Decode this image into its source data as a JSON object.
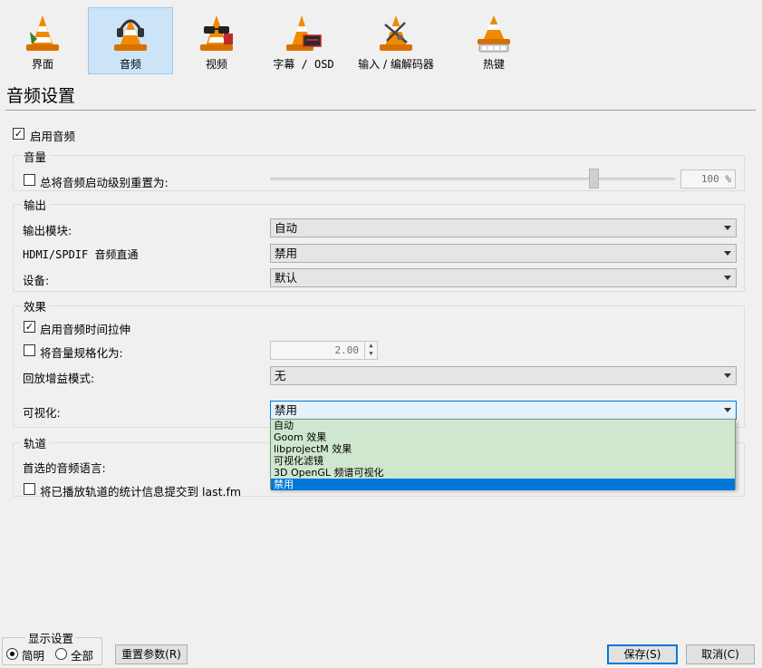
{
  "toolbar": {
    "items": [
      {
        "label": "界面",
        "icon": "vlc-cone-interface-icon"
      },
      {
        "label": "音频",
        "icon": "vlc-cone-headphones-icon"
      },
      {
        "label": "视频",
        "icon": "vlc-cone-glasses-icon"
      },
      {
        "label": "字幕 / OSD",
        "icon": "vlc-cone-subtitle-icon"
      },
      {
        "label": "输入 / 编解码器",
        "icon": "vlc-cone-codec-icon"
      },
      {
        "label": "热键",
        "icon": "vlc-cone-hotkeys-icon"
      }
    ],
    "active": "音频"
  },
  "page_title": "音频设置",
  "enable_audio": {
    "label": "启用音频",
    "checked": true
  },
  "volume": {
    "group_title": "音量",
    "reset_label": "总将音频启动级别重置为:",
    "reset_checked": false,
    "value_text": "100 %",
    "level_percent": 100
  },
  "output": {
    "group_title": "输出",
    "module_label": "输出模块:",
    "module_value": "自动",
    "passthrough_label": "HDMI/SPDIF 音频直通",
    "passthrough_value": "禁用",
    "device_label": "设备:",
    "device_value": "默认"
  },
  "effects": {
    "group_title": "效果",
    "timestretch_label": "启用音频时间拉伸",
    "timestretch_checked": true,
    "normalize_label": "将音量规格化为:",
    "normalize_checked": false,
    "normalize_value": "2.00",
    "replaygain_label": "回放增益模式:",
    "replaygain_value": "无",
    "visualization_label": "可视化:",
    "visualization_value": "禁用",
    "visualization_options": [
      "自动",
      "Goom 效果",
      "libprojectM 效果",
      "可视化滤镜",
      "3D OpenGL 频谱可视化",
      "禁用"
    ],
    "visualization_selected_index": 5
  },
  "tracks": {
    "group_title": "轨道",
    "preferred_lang_label": "首选的音频语言:",
    "lastfm_label": "将已播放轨道的统计信息提交到 last.fm",
    "lastfm_checked": false
  },
  "bottom": {
    "display_title": "显示设置",
    "simple_label": "简明",
    "all_label": "全部",
    "selected_mode": "简明",
    "reset_button": "重置参数(R)",
    "save_button": "保存(S)",
    "cancel_button": "取消(C)"
  },
  "colors": {
    "accent": "#0078d7",
    "active_tab_bg": "#cce4f7",
    "popup_bg": "#cfe6cf",
    "cone_orange": "#f08a00"
  }
}
